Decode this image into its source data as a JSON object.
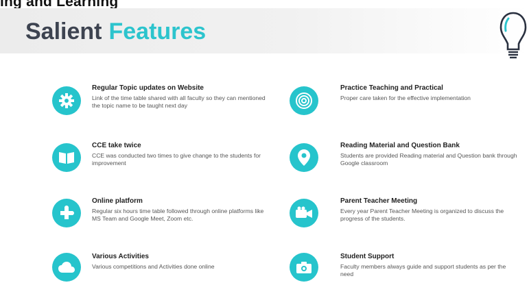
{
  "header": {
    "top_text": "ing and Learning",
    "title_word1": "Salient",
    "title_word2": "Features"
  },
  "colors": {
    "accent": "#26c4cc",
    "title_dark": "#3d4350",
    "title_teal": "#2cc4cd"
  },
  "features": [
    {
      "title": "Regular Topic updates on Website",
      "description": "Link of the time table shared with all faculty so they can mentioned the topic name to be taught next day",
      "icon": "gear-icon"
    },
    {
      "title": "Practice Teaching and Practical",
      "description": "Proper care taken for the effective implementation",
      "icon": "target-icon"
    },
    {
      "title": "CCE take twice",
      "description": "CCE was conducted two times to give change to the students for improvement",
      "icon": "book-icon"
    },
    {
      "title": "Reading Material and Question Bank",
      "description": "Students are provided Reading material and Question bank through Google classroom",
      "icon": "location-pin-icon"
    },
    {
      "title": "Online platform",
      "description": "Regular six hours time table followed through online platforms like MS Team and Google Meet, Zoom etc.",
      "icon": "puzzle-icon"
    },
    {
      "title": "Parent Teacher Meeting",
      "description": "Every year Parent Teacher Meeting is organized to discuss the progress of the students.",
      "icon": "video-camera-icon"
    },
    {
      "title": "Various Activities",
      "description": "Various competitions and Activities done online",
      "icon": "cloud-icon"
    },
    {
      "title": "Student Support",
      "description": "Faculty members always guide and support students as per the need",
      "icon": "camera-icon"
    }
  ]
}
